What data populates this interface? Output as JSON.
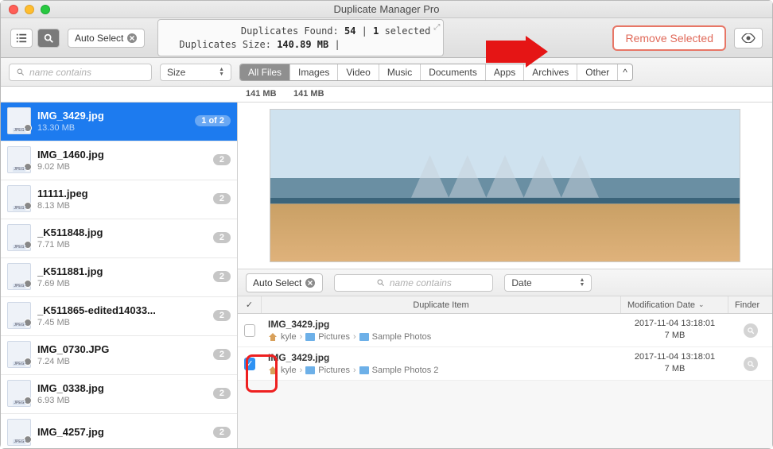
{
  "window": {
    "title": "Duplicate Manager Pro"
  },
  "toolbar": {
    "auto_select_label": "Auto Select",
    "remove_label": "Remove Selected",
    "stats_line1_pre": "Duplicates Found: ",
    "stats_line1_count": "54",
    "stats_line1_mid": " | ",
    "stats_line1_sel": "1",
    "stats_line1_post": " selected",
    "stats_line2_pre": "Duplicates Size: ",
    "stats_line2_size": "140.89 MB",
    "stats_line2_post": " | "
  },
  "filter": {
    "search_placeholder": "name contains",
    "sort_label": "Size",
    "tabs": [
      "All Files",
      "Images",
      "Video",
      "Music",
      "Documents",
      "Apps",
      "Archives",
      "Other"
    ],
    "active_tab_index": 0,
    "size_cells": [
      "141 MB",
      "141 MB"
    ]
  },
  "sidebar": {
    "items": [
      {
        "name": "IMG_3429.jpg",
        "meta": "13.30 MB",
        "badge": "1 of 2",
        "selected": true
      },
      {
        "name": "IMG_1460.jpg",
        "meta": "9.02 MB",
        "badge": "2",
        "selected": false
      },
      {
        "name": "11111.jpeg",
        "meta": "8.13 MB",
        "badge": "2",
        "selected": false
      },
      {
        "name": "_K511848.jpg",
        "meta": "7.71 MB",
        "badge": "2",
        "selected": false
      },
      {
        "name": "_K511881.jpg",
        "meta": "7.69 MB",
        "badge": "2",
        "selected": false
      },
      {
        "name": "_K511865-edited14033...",
        "meta": "7.45 MB",
        "badge": "2",
        "selected": false
      },
      {
        "name": "IMG_0730.JPG",
        "meta": "7.24 MB",
        "badge": "2",
        "selected": false
      },
      {
        "name": "IMG_0338.jpg",
        "meta": "6.93 MB",
        "badge": "2",
        "selected": false
      },
      {
        "name": "IMG_4257.jpg",
        "meta": "",
        "badge": "2",
        "selected": false
      }
    ]
  },
  "detail": {
    "auto_select_label": "Auto Select",
    "search_placeholder": "name contains",
    "sort_label": "Date",
    "columns": {
      "item": "Duplicate Item",
      "mod": "Modification Date",
      "finder": "Finder"
    },
    "rows": [
      {
        "checked": false,
        "name": "IMG_3429.jpg",
        "path": [
          "kyle",
          "Pictures",
          "Sample Photos"
        ],
        "date": "2017-11-04 13:18:01",
        "size": "7 MB"
      },
      {
        "checked": true,
        "name": "IMG_3429.jpg",
        "path": [
          "kyle",
          "Pictures",
          "Sample Photos 2"
        ],
        "date": "2017-11-04 13:18:01",
        "size": "7 MB"
      }
    ]
  }
}
